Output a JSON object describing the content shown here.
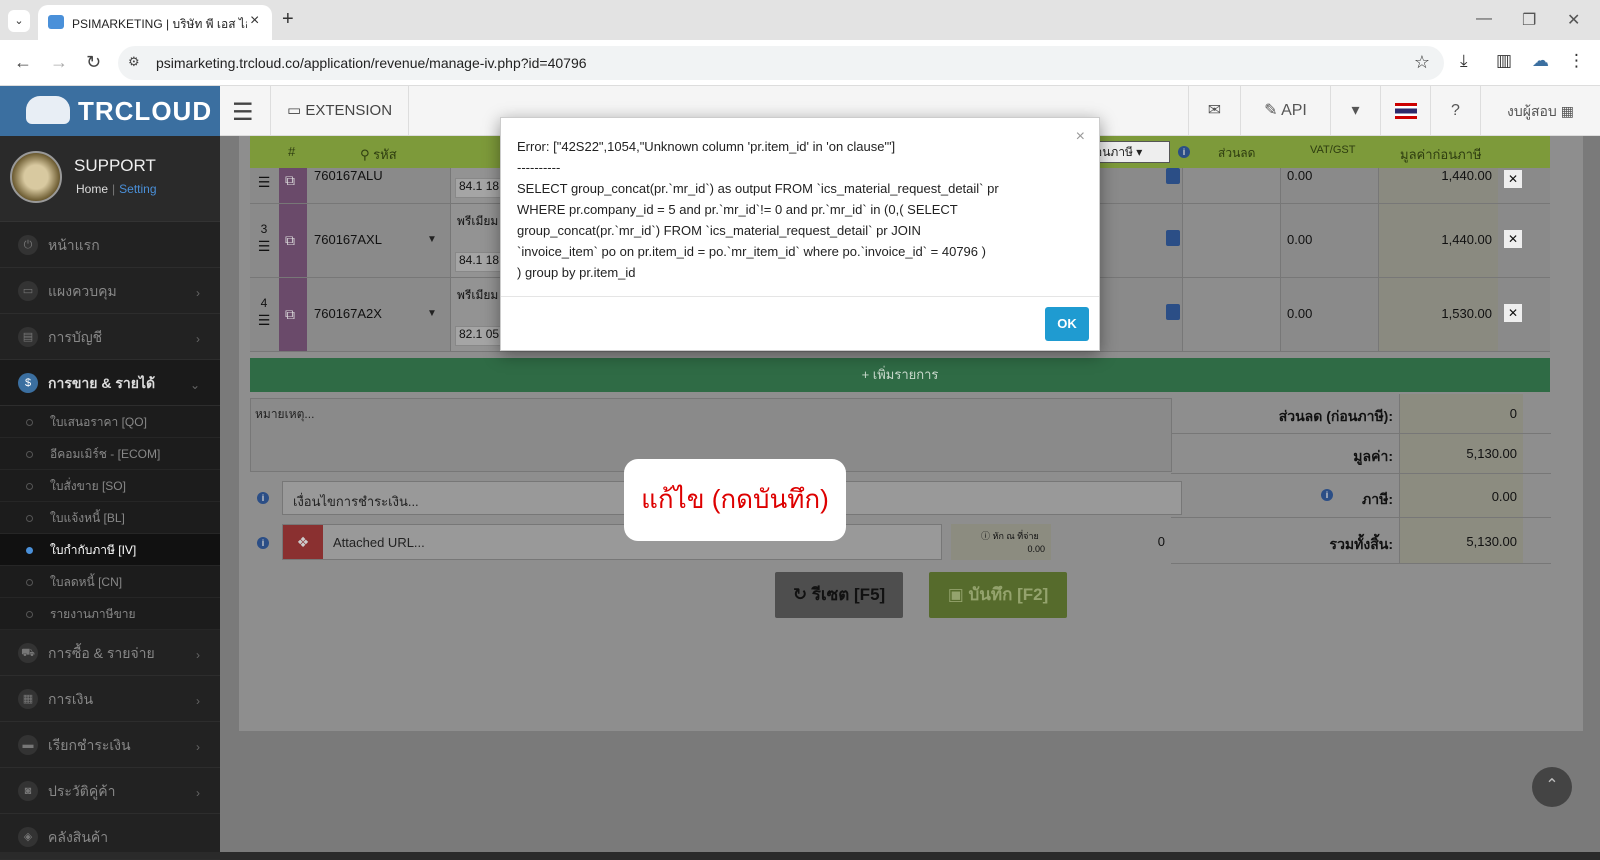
{
  "browser": {
    "tab_title": "PSIMARKETING | บริษัท พี เอส ไอ",
    "url": "psimarketing.trcloud.co/application/revenue/manage-iv.php?id=40796"
  },
  "header": {
    "brand": "TRCLOUD",
    "extension": "EXTENSION",
    "api": "API",
    "user": "งบผู้สอบ"
  },
  "profile": {
    "name": "SUPPORT",
    "home": "Home",
    "sep": "|",
    "setting": "Setting"
  },
  "sidebar": {
    "items": [
      {
        "label": "หน้าแรก",
        "icon": "power-icon"
      },
      {
        "label": "แผงควบคุม",
        "icon": "monitor-icon"
      },
      {
        "label": "การบัญชี",
        "icon": "book-icon"
      },
      {
        "label": "การขาย & รายได้",
        "icon": "dollar-icon"
      },
      {
        "label": "การซื้อ & รายจ่าย",
        "icon": "cart-icon"
      },
      {
        "label": "การเงิน",
        "icon": "calendar-icon"
      },
      {
        "label": "เรียกชำระเงิน",
        "icon": "card-icon"
      },
      {
        "label": "ประวัติคู่ค้า",
        "icon": "contact-icon"
      },
      {
        "label": "คลังสินค้า",
        "icon": "cubes-icon"
      }
    ],
    "sub_items": [
      "ใบเสนอราคา [QO]",
      "อีคอมเมิร์ช - [ECOM]",
      "ใบสั่งขาย [SO]",
      "ใบแจ้งหนี้ [BL]",
      "ใบกำกับภาษี [IV]",
      "ใบลดหนี้ [CN]",
      "รายงานภาษีขาย"
    ]
  },
  "table": {
    "headers": {
      "num": "#",
      "code": "รหัส",
      "vat_select": "อนภาษี",
      "discount": "ส่วนลด",
      "vat": "VAT/GST",
      "amount": "มูลค่าก่อนภาษี"
    },
    "rows": [
      {
        "num": "",
        "code": "760167ALU",
        "desc": "",
        "desc2": "84.1 18.",
        "vat": "0.00",
        "amount": "1,440.00"
      },
      {
        "num": "3",
        "code": "760167AXL",
        "desc": "พรีเมียม",
        "desc2": "84.1 18.",
        "vat": "0.00",
        "amount": "1,440.00"
      },
      {
        "num": "4",
        "code": "760167A2X",
        "desc": "พรีเมียม",
        "desc2": "82.1 05",
        "vat": "0.00",
        "amount": "1,530.00"
      }
    ],
    "add_row": "+ เพิ่มรายการ",
    "notes_placeholder": "หมายเหตุ..."
  },
  "summary": {
    "discount_label": "ส่วนลด (ก่อนภาษี):",
    "discount_value": "0",
    "value_label": "มูลค่า:",
    "value": "5,130.00",
    "tax_label": "ภาษี:",
    "tax_value": "0.00",
    "total_label": "รวมทั้งสิ้น:",
    "total_value": "5,130.00"
  },
  "form": {
    "conditions_placeholder": "เงื่อนไขการชำระเงิน...",
    "url_placeholder": "Attached URL...",
    "wht_label": "หัก ณ ที่จ่าย",
    "wht_value": "0.00",
    "wht_amount": "0"
  },
  "buttons": {
    "reset": "รีเซต [F5]",
    "save": "บันทึก [F2]"
  },
  "dialog": {
    "lines": [
      "Error: [\"42S22\",1054,\"Unknown column 'pr.item_id' in 'on clause'\"]",
      "----------",
      "SELECT group_concat(pr.`mr_id`) as output FROM `ics_material_request_detail` pr",
      "WHERE pr.company_id = 5 and pr.`mr_id`!= 0 and pr.`mr_id` in (0,( SELECT",
      "group_concat(pr.`mr_id`) FROM `ics_material_request_detail` pr JOIN",
      "`invoice_item` po on pr.item_id = po.`mr_item_id` where po.`invoice_id` = 40796 )",
      ") group by pr.item_id"
    ],
    "ok": "OK",
    "close": "×"
  },
  "callout": "แก้ไข (กดบันทึก)"
}
